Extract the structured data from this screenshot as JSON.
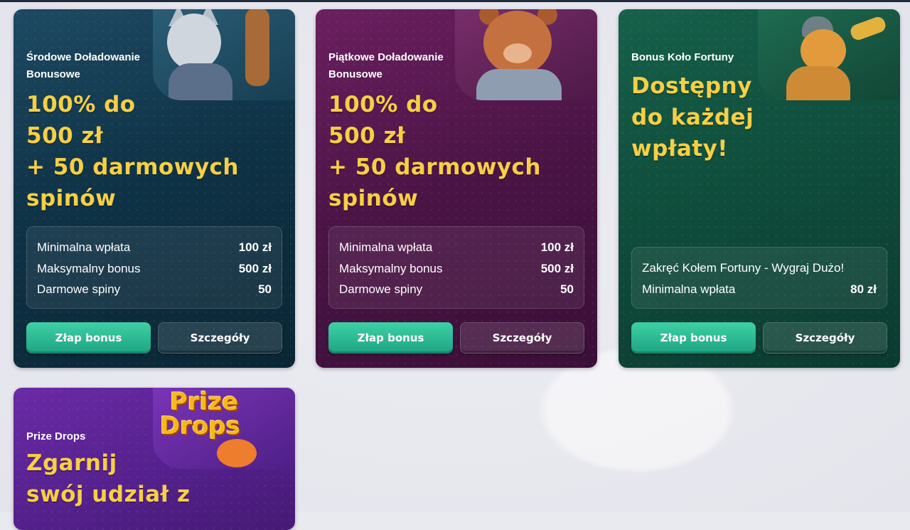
{
  "promotions": [
    {
      "subtitle": "Środowe Doładowanie Bonusowe",
      "headline": [
        "100% do",
        "500 zł",
        "+ 50 darmowych",
        "spinów"
      ],
      "details": [
        {
          "label": "Minimalna wpłata",
          "value": "100 zł"
        },
        {
          "label": "Maksymalny bonus",
          "value": "500 zł"
        },
        {
          "label": "Darmowe spiny",
          "value": "50"
        }
      ],
      "primary_button": "Złap bonus",
      "secondary_button": "Szczegóły",
      "mascot": "wolf-mascot-icon"
    },
    {
      "subtitle": "Piątkowe Doładowanie Bonusowe",
      "headline": [
        "100% do",
        "500 zł",
        "+ 50 darmowych",
        "spinów"
      ],
      "details": [
        {
          "label": "Minimalna wpłata",
          "value": "100 zł"
        },
        {
          "label": "Maksymalny bonus",
          "value": "500 zł"
        },
        {
          "label": "Darmowe spiny",
          "value": "50"
        }
      ],
      "primary_button": "Złap bonus",
      "secondary_button": "Szczegóły",
      "mascot": "bear-mascot-icon"
    },
    {
      "subtitle": "Bonus Koło Fortuny",
      "headline": [
        "Dostępny",
        "do każdej",
        "wpłaty!"
      ],
      "details": [
        {
          "label": "Zakręć Kołem Fortuny - Wygraj Dużo!",
          "value": ""
        },
        {
          "label": "Minimalna wpłata",
          "value": "80 zł"
        }
      ],
      "primary_button": "Złap bonus",
      "secondary_button": "Szczegóły",
      "mascot": "squirrel-mascot-icon"
    },
    {
      "subtitle": "Prize Drops",
      "headline": [
        "Zgarnij",
        "swój udział z"
      ],
      "logo_line1": "Prize",
      "logo_line2": "Drops",
      "mascot": "fox-mascot-icon"
    }
  ],
  "colors": {
    "accent_yellow": "#f6cf45",
    "button_green": "#2bbf93",
    "card_teal": "#0f3347",
    "card_purple": "#4a1445",
    "card_green": "#0f4c3b",
    "card_violet": "#53208a"
  }
}
